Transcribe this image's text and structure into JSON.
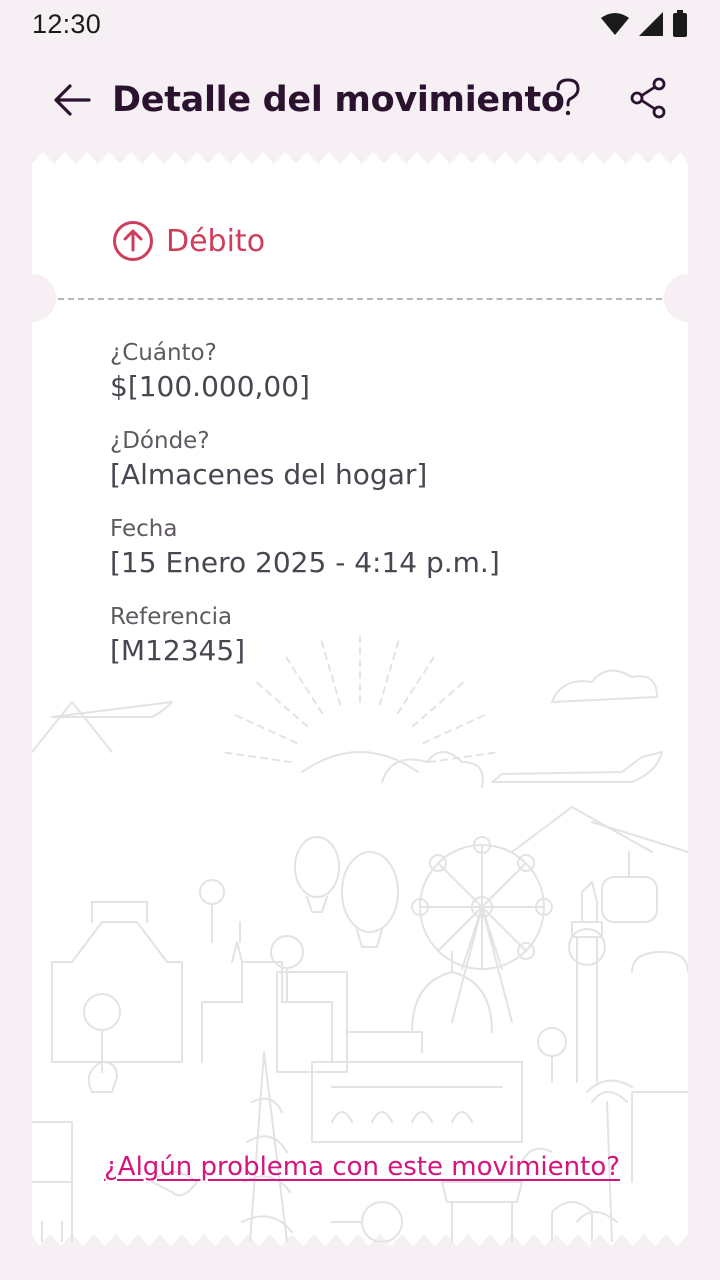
{
  "status_bar": {
    "time": "12:30"
  },
  "header": {
    "title": "Detalle del movimiento",
    "back_icon": "arrow-left-icon",
    "help_icon": "question-mark-icon",
    "share_icon": "share-icon"
  },
  "movement": {
    "type_icon": "arrow-up-circle-icon",
    "type_label": "Débito",
    "fields": [
      {
        "label": "¿Cuánto?",
        "value": "$[100.000,00]"
      },
      {
        "label": "¿Dónde?",
        "value": "[Almacenes del hogar]"
      },
      {
        "label": "Fecha",
        "value": "[15 Enero 2025 - 4:14 p.m.]"
      },
      {
        "label": "Referencia",
        "value": "[M12345]"
      }
    ]
  },
  "footer": {
    "problem_link": "¿Algún problema con este movimiento?"
  },
  "colors": {
    "background": "#f6eff4",
    "title": "#2b1330",
    "debit": "#d03d5c",
    "link": "#d6147e",
    "value": "#4a4550"
  }
}
